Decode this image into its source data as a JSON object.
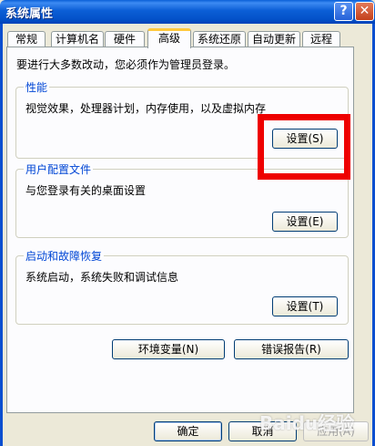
{
  "window": {
    "title": "系统属性",
    "help_glyph": "?",
    "close_glyph": "✕"
  },
  "tabs": [
    {
      "label": "常规"
    },
    {
      "label": "计算机名"
    },
    {
      "label": "硬件"
    },
    {
      "label": "高级"
    },
    {
      "label": "系统还原"
    },
    {
      "label": "自动更新"
    },
    {
      "label": "远程"
    }
  ],
  "intro": "要进行大多数改动，您必须作为管理员登录。",
  "groups": {
    "performance": {
      "title": "性能",
      "desc": "视觉效果，处理器计划，内存使用，以及虚拟内存",
      "button": "设置(S)"
    },
    "profile": {
      "title": "用户配置文件",
      "desc": "与您登录有关的桌面设置",
      "button": "设置(E)"
    },
    "startup": {
      "title": "启动和故障恢复",
      "desc": "系统启动，系统失败和调试信息",
      "button": "设置(T)"
    }
  },
  "buttons": {
    "env": "环境变量(N)",
    "error": "错误报告(R)",
    "ok": "确定",
    "cancel": "取消",
    "apply": "应用(A)"
  },
  "watermark": "Baidu经验",
  "colors": {
    "title_blue": "#0452c9",
    "highlight_red": "#ee0000",
    "legend_blue": "#0046d5"
  }
}
